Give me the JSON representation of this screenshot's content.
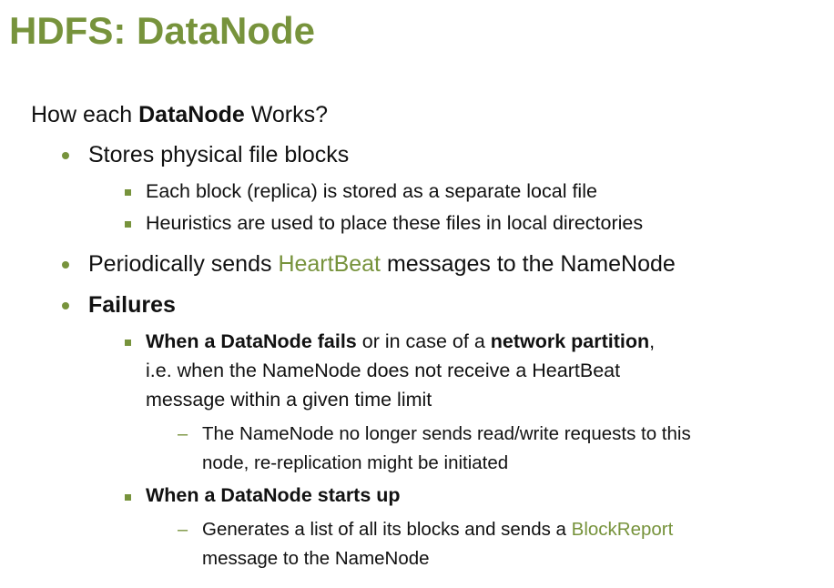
{
  "title": "HDFS: DataNode",
  "intro": {
    "prefix": "How each ",
    "bold": "DataNode",
    "suffix": " Works?"
  },
  "bullet1": {
    "text": "Stores physical file blocks",
    "sub1": "Each block (replica) is stored as a separate local file",
    "sub2": "Heuristics are used to place these files in local directories"
  },
  "bullet2": {
    "prefix": "Periodically sends ",
    "highlight": "HeartBeat",
    "suffix": " messages to the NameNode"
  },
  "bullet3": {
    "label": "Failures",
    "sub1": {
      "bold1": "When a DataNode fails",
      "mid": " or in case of a ",
      "bold2": "network partition",
      "end": ",",
      "line2": "i.e. when the NameNode does not receive a HeartBeat",
      "line3": "message within a given time limit",
      "dash1": "The NameNode no longer sends read/write requests to this",
      "dash1b": "node, re-replication might be initiated"
    },
    "sub2": {
      "bold": "When a DataNode starts up",
      "dash1_prefix": "Generates a list of all its blocks and sends a ",
      "dash1_highlight": "BlockReport",
      "dash1b": "message to the NameNode"
    }
  },
  "colors": {
    "accent": "#77933C",
    "text": "#111111"
  }
}
